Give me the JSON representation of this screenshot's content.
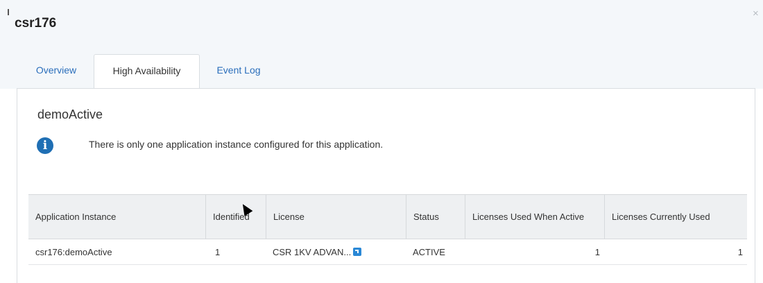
{
  "dialog": {
    "title": "csr176",
    "close_glyph": "×"
  },
  "tabs": [
    {
      "label": "Overview"
    },
    {
      "label": "High Availability",
      "active": true
    },
    {
      "label": "Event Log"
    }
  ],
  "panel": {
    "title": "demoActive",
    "info_message": "There is only one application instance configured for this application.",
    "info_icon": "info-icon"
  },
  "grid": {
    "columns": [
      "Application Instance",
      "Identified",
      "License",
      "Status",
      "Licenses Used When Active",
      "Licenses Currently Used"
    ],
    "rows": [
      {
        "instance": "csr176:demoActive",
        "identified": "1",
        "license": "CSR 1KV ADVAN...",
        "status": "ACTIVE",
        "used_when_active": "1",
        "currently_used": "1"
      }
    ]
  },
  "colors": {
    "accent": "#2a6ebb",
    "info": "#1f6fb4",
    "header_bg": "#f4f7fa",
    "grid_header_bg": "#eef0f2"
  }
}
